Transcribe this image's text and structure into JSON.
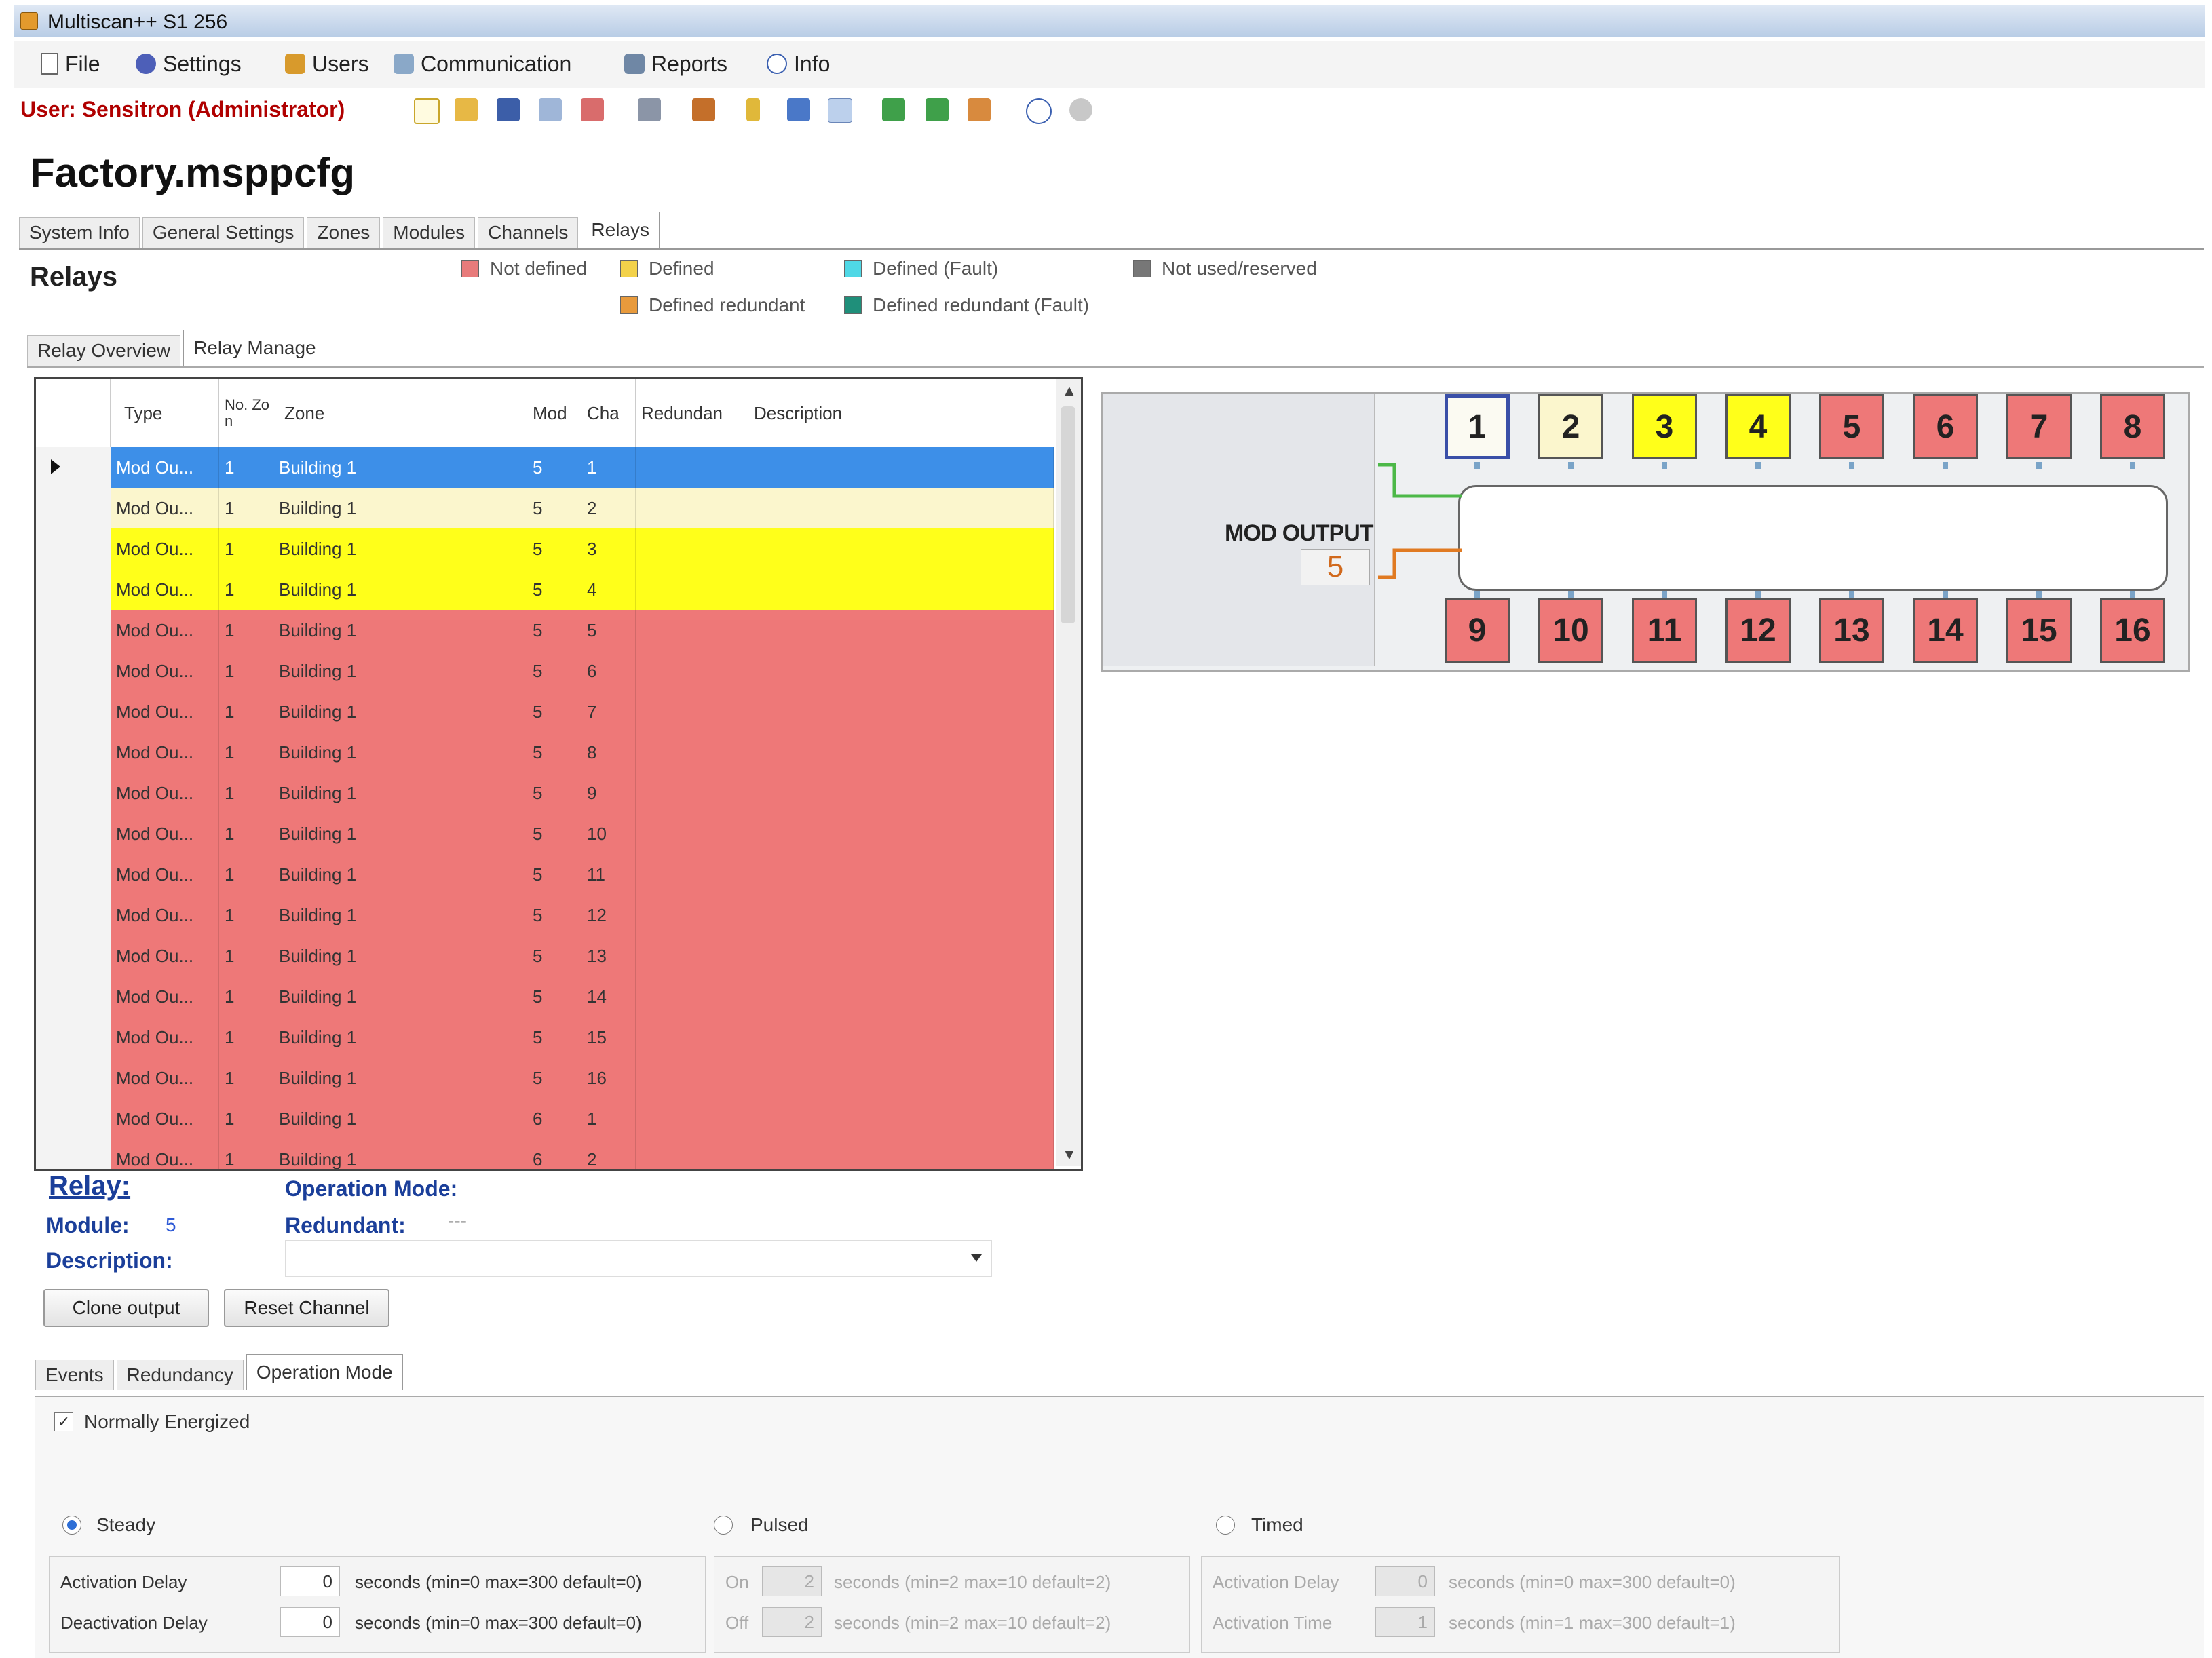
{
  "window": {
    "title": "Multiscan++ S1 256"
  },
  "menu": [
    {
      "label": "File",
      "icon": "file-icon"
    },
    {
      "label": "Settings",
      "icon": "settings-icon"
    },
    {
      "label": "Users",
      "icon": "users-icon"
    },
    {
      "label": "Communication",
      "icon": "communication-icon"
    },
    {
      "label": "Reports",
      "icon": "reports-icon"
    },
    {
      "label": "Info",
      "icon": "info-icon"
    }
  ],
  "user_label": "User: Sensitron (Administrator)",
  "file_title": "Factory.msppcfg",
  "main_tabs": [
    "System Info",
    "General Settings",
    "Zones",
    "Modules",
    "Channels",
    "Relays"
  ],
  "section_title": "Relays",
  "legend": [
    {
      "label": "Not defined",
      "color": "#e87b7b"
    },
    {
      "label": "Defined",
      "color": "#f3d24a"
    },
    {
      "label": "Defined (Fault)",
      "color": "#4fd8e6"
    },
    {
      "label": "Not used/reserved",
      "color": "#777777"
    },
    {
      "label": "Defined redundant",
      "color": "#e89a3c"
    },
    {
      "label": "Defined redundant (Fault)",
      "color": "#1f8f7a"
    }
  ],
  "sub_tabs": [
    "Relay Overview",
    "Relay Manage"
  ],
  "grid": {
    "columns": [
      "Type",
      "No. Zon",
      "Zone",
      "Mod",
      "Cha",
      "Redundan",
      "Description"
    ],
    "rows": [
      {
        "type": "Mod Ou...",
        "nozones": "1",
        "zone": "Building 1",
        "mod": "5",
        "cha": "1",
        "state": "selected"
      },
      {
        "type": "Mod Ou...",
        "nozones": "1",
        "zone": "Building 1",
        "mod": "5",
        "cha": "2",
        "state": "pale"
      },
      {
        "type": "Mod Ou...",
        "nozones": "1",
        "zone": "Building 1",
        "mod": "5",
        "cha": "3",
        "state": "yellow"
      },
      {
        "type": "Mod Ou...",
        "nozones": "1",
        "zone": "Building 1",
        "mod": "5",
        "cha": "4",
        "state": "yellow"
      },
      {
        "type": "Mod Ou...",
        "nozones": "1",
        "zone": "Building 1",
        "mod": "5",
        "cha": "5",
        "state": "red"
      },
      {
        "type": "Mod Ou...",
        "nozones": "1",
        "zone": "Building 1",
        "mod": "5",
        "cha": "6",
        "state": "red"
      },
      {
        "type": "Mod Ou...",
        "nozones": "1",
        "zone": "Building 1",
        "mod": "5",
        "cha": "7",
        "state": "red"
      },
      {
        "type": "Mod Ou...",
        "nozones": "1",
        "zone": "Building 1",
        "mod": "5",
        "cha": "8",
        "state": "red"
      },
      {
        "type": "Mod Ou...",
        "nozones": "1",
        "zone": "Building 1",
        "mod": "5",
        "cha": "9",
        "state": "red"
      },
      {
        "type": "Mod Ou...",
        "nozones": "1",
        "zone": "Building 1",
        "mod": "5",
        "cha": "10",
        "state": "red"
      },
      {
        "type": "Mod Ou...",
        "nozones": "1",
        "zone": "Building 1",
        "mod": "5",
        "cha": "11",
        "state": "red"
      },
      {
        "type": "Mod Ou...",
        "nozones": "1",
        "zone": "Building 1",
        "mod": "5",
        "cha": "12",
        "state": "red"
      },
      {
        "type": "Mod Ou...",
        "nozones": "1",
        "zone": "Building 1",
        "mod": "5",
        "cha": "13",
        "state": "red"
      },
      {
        "type": "Mod Ou...",
        "nozones": "1",
        "zone": "Building 1",
        "mod": "5",
        "cha": "14",
        "state": "red"
      },
      {
        "type": "Mod Ou...",
        "nozones": "1",
        "zone": "Building 1",
        "mod": "5",
        "cha": "15",
        "state": "red"
      },
      {
        "type": "Mod Ou...",
        "nozones": "1",
        "zone": "Building 1",
        "mod": "5",
        "cha": "16",
        "state": "red"
      },
      {
        "type": "Mod Ou...",
        "nozones": "1",
        "zone": "Building 1",
        "mod": "6",
        "cha": "1",
        "state": "red"
      },
      {
        "type": "Mod Ou...",
        "nozones": "1",
        "zone": "Building 1",
        "mod": "6",
        "cha": "2",
        "state": "red"
      }
    ]
  },
  "diagram": {
    "module_label": "MOD OUTPUT",
    "module_number": "5",
    "relays": [
      {
        "n": "1",
        "state": "selected"
      },
      {
        "n": "2",
        "state": "pale"
      },
      {
        "n": "3",
        "state": "yellow"
      },
      {
        "n": "4",
        "state": "yellow"
      },
      {
        "n": "5",
        "state": "red"
      },
      {
        "n": "6",
        "state": "red"
      },
      {
        "n": "7",
        "state": "red"
      },
      {
        "n": "8",
        "state": "red"
      },
      {
        "n": "9",
        "state": "red"
      },
      {
        "n": "10",
        "state": "red"
      },
      {
        "n": "11",
        "state": "red"
      },
      {
        "n": "12",
        "state": "red"
      },
      {
        "n": "13",
        "state": "red"
      },
      {
        "n": "14",
        "state": "red"
      },
      {
        "n": "15",
        "state": "red"
      },
      {
        "n": "16",
        "state": "red"
      }
    ]
  },
  "detail": {
    "relay_label": "Relay:",
    "module_label": "Module:",
    "module_value": "5",
    "description_label": "Description:",
    "opmode_label": "Operation Mode:",
    "redundant_label": "Redundant:",
    "redundant_value": "---",
    "clone_button": "Clone output",
    "reset_button": "Reset Channel"
  },
  "bottom_tabs": [
    "Events",
    "Redundancy",
    "Operation Mode"
  ],
  "opmode": {
    "normally_energized": "Normally Energized",
    "steady": "Steady",
    "pulsed": "Pulsed",
    "timed": "Timed",
    "activation_delay_label": "Activation Delay",
    "activation_delay_value": "0",
    "activation_delay_hint": "seconds (min=0 max=300 default=0)",
    "deactivation_delay_label": "Deactivation Delay",
    "deactivation_delay_value": "0",
    "deactivation_delay_hint": "seconds (min=0 max=300 default=0)",
    "on_label": "On",
    "on_value": "2",
    "on_hint": "seconds (min=2 max=10 default=2)",
    "off_label": "Off",
    "off_value": "2",
    "off_hint": "seconds (min=2 max=10 default=2)",
    "timed_delay_label": "Activation Delay",
    "timed_delay_value": "0",
    "timed_delay_hint": "seconds (min=0 max=300 default=0)",
    "timed_time_label": "Activation Time",
    "timed_time_value": "1",
    "timed_time_hint": "seconds (min=1 max=300 default=1)"
  },
  "colors": {
    "selected": "#3d8fe8",
    "pale": "#fbf6cd",
    "yellow": "#ffff1a",
    "red": "#ee7878"
  }
}
